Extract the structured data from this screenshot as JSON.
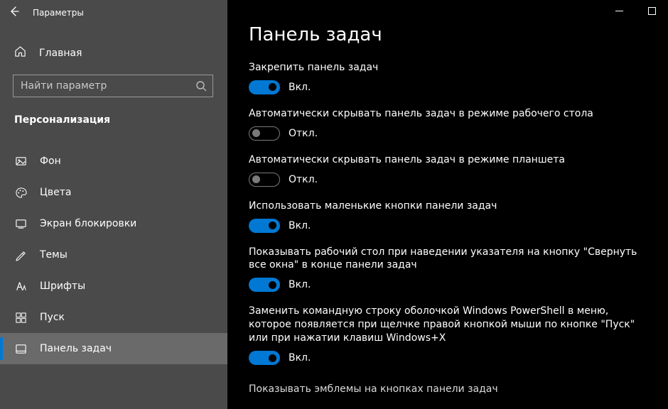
{
  "window": {
    "title": "Параметры"
  },
  "sidebar": {
    "home_label": "Главная",
    "search_placeholder": "Найти параметр",
    "category": "Персонализация",
    "items": [
      {
        "label": "Фон"
      },
      {
        "label": "Цвета"
      },
      {
        "label": "Экран блокировки"
      },
      {
        "label": "Темы"
      },
      {
        "label": "Шрифты"
      },
      {
        "label": "Пуск"
      },
      {
        "label": "Панель задач"
      }
    ]
  },
  "main": {
    "title": "Панель задач",
    "toggle_state": {
      "on": "Вкл.",
      "off": "Откл."
    },
    "settings": [
      {
        "label": "Закрепить панель задач",
        "on": true
      },
      {
        "label": "Автоматически скрывать панель задач в режиме рабочего стола",
        "on": false
      },
      {
        "label": "Автоматически скрывать панель задач в режиме планшета",
        "on": false
      },
      {
        "label": "Использовать маленькие кнопки панели задач",
        "on": true
      },
      {
        "label": "Показывать рабочий стол при наведении указателя на кнопку \"Свернуть все окна\" в конце панели задач",
        "on": true
      },
      {
        "label": "Заменить командную строку оболочкой Windows PowerShell в меню, которое появляется при щелчке правой кнопкой мыши по кнопке \"Пуск\" или при нажатии клавиш Windows+X",
        "on": true
      }
    ],
    "cutoff_label": "Показывать эмблемы на кнопках панели задач"
  }
}
